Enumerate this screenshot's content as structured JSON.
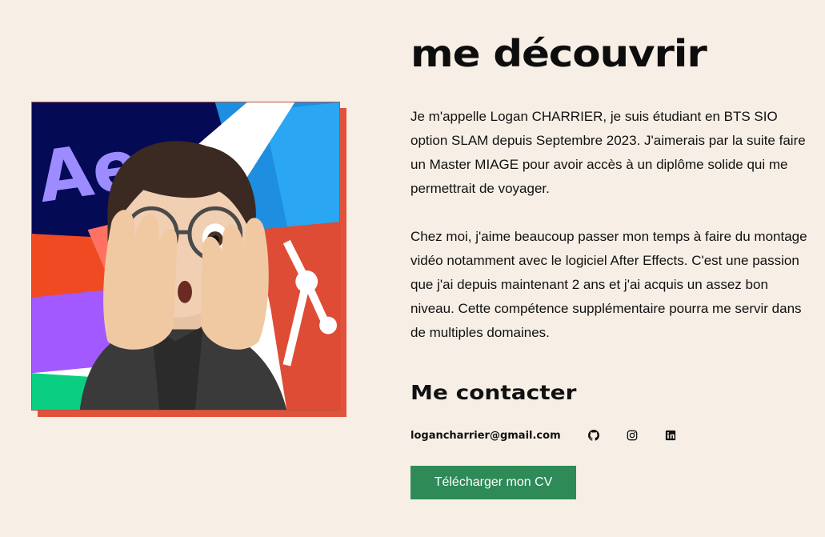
{
  "about": {
    "title": "me découvrir",
    "paragraphs": [
      "Je m'appelle Logan CHARRIER, je suis étudiant en BTS SIO option SLAM depuis Septembre 2023. J'aimerais par la suite faire un Master MIAGE pour avoir accès à un diplôme solide qui me permettrait de voyager.",
      "Chez moi, j'aime beaucoup passer mon temps à faire du montage vidéo notamment avec le logiciel After Effects. C'est une passion que j'ai depuis maintenant 2 ans et j'ai acquis un assez bon niveau. Cette compétence supplémentaire pourra me servir dans de multiples domaines."
    ]
  },
  "portrait": {
    "badge_text": "Ae",
    "shadow_color": "#e0533a"
  },
  "contact": {
    "title": "Me contacter",
    "email": "logancharrier@gmail.com",
    "socials": [
      {
        "icon": "github-icon"
      },
      {
        "icon": "instagram-icon"
      },
      {
        "icon": "linkedin-icon"
      }
    ]
  },
  "cv_button": {
    "label": "Télécharger mon CV",
    "color": "#2e8a57"
  }
}
